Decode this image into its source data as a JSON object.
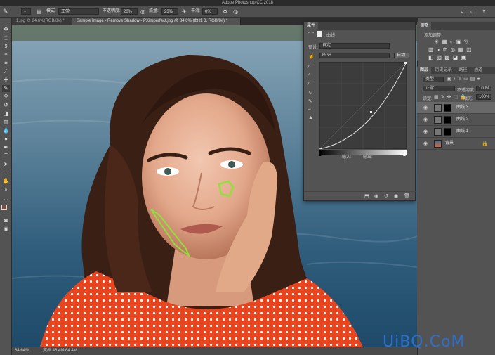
{
  "app": {
    "title": "Adobe Photoshop CC 2018"
  },
  "options_bar": {
    "mode_label": "模式:",
    "mode_value": "正常",
    "opacity_label": "不透明度:",
    "opacity_value": "20%",
    "flow_label": "流量:",
    "flow_value": "23%",
    "smooth_label": "平滑:",
    "smooth_value": "0%"
  },
  "tabs": [
    {
      "label": "1.jpg @ 84.6%(RGB/8#) *"
    },
    {
      "label": "Sample Image - Remove Shadow - PXimperfect.jpg @ 84.6% (曲线 3, RGB/8#) *"
    }
  ],
  "status": {
    "zoom": "84.64%",
    "doc": "文档:46.4M/64.4M"
  },
  "adjustments": {
    "tab": "调整",
    "add_label": "添加调整"
  },
  "properties": {
    "tab": "属性",
    "header": "曲线",
    "preset_label": "预设:",
    "preset_value": "自定",
    "channel_value": "RGB",
    "auto_button": "自动",
    "input_label": "输入:",
    "output_label": "输出:"
  },
  "layers_panel": {
    "tabs": [
      "图层",
      "历史记录",
      "路径",
      "通道"
    ],
    "filter_value": "类型",
    "blend_value": "正常",
    "opacity_label": "不透明度:",
    "opacity_value": "100%",
    "lock_label": "锁定:",
    "fill_label": "填充:",
    "fill_value": "100%",
    "layers": [
      {
        "name": "曲线 3"
      },
      {
        "name": "曲线 2"
      },
      {
        "name": "曲线 1"
      },
      {
        "name": "背景"
      }
    ]
  },
  "watermark": "UiBQ.CoM",
  "colors": {
    "accent_green": "#8fe03a",
    "watermark": "#2d6fcb",
    "panel": "#535353"
  }
}
